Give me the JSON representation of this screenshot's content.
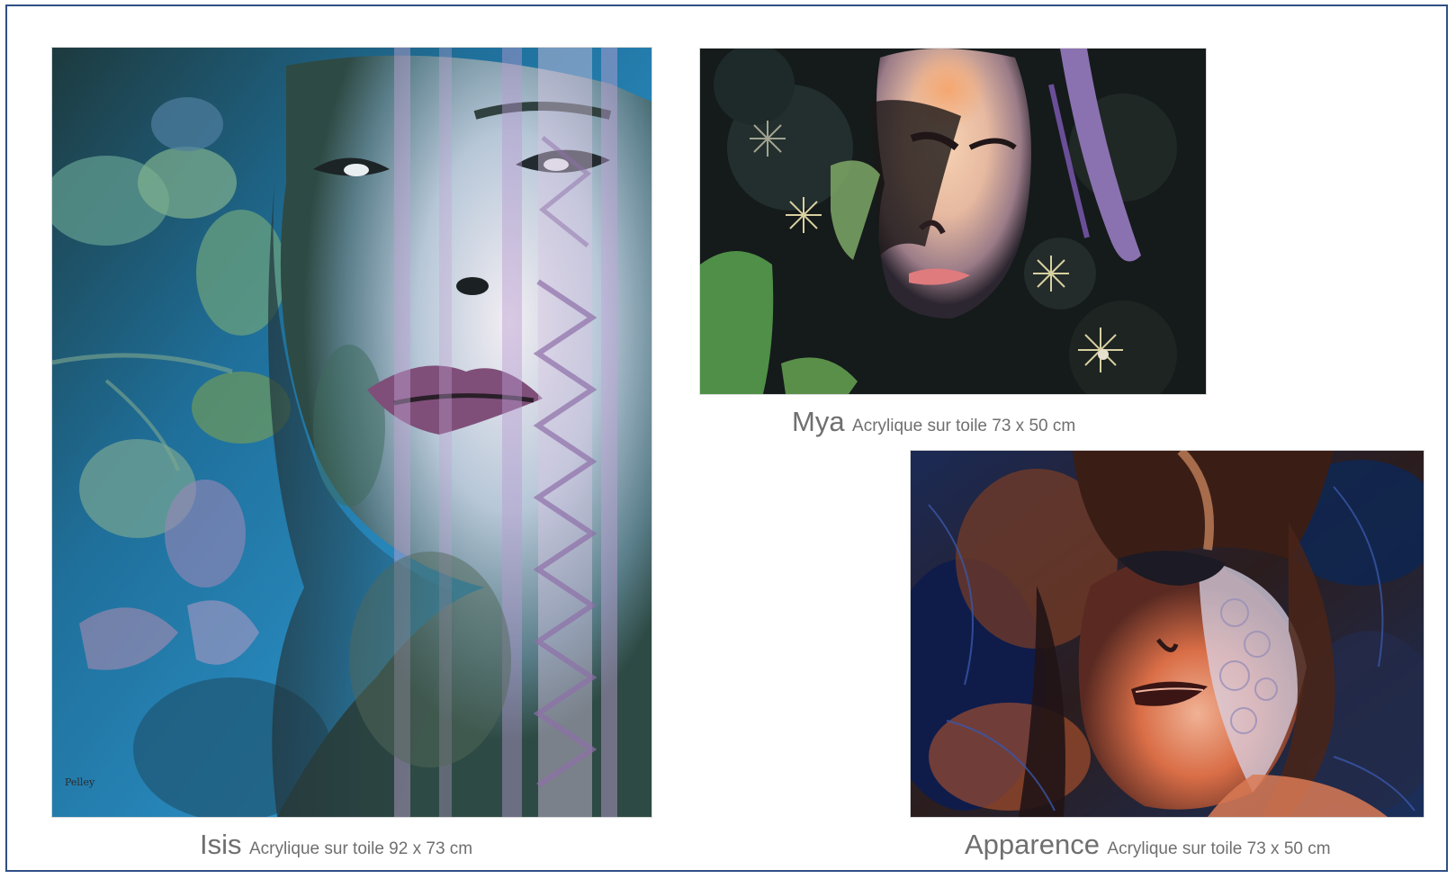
{
  "artworks": {
    "isis": {
      "title": "Isis",
      "details": "Acrylique sur toile 92 x 73 cm",
      "signature": "Pelley"
    },
    "mya": {
      "title": "Mya",
      "details": "Acrylique sur toile 73 x 50 cm"
    },
    "apparence": {
      "title": "Apparence",
      "details": "Acrylique sur toile 73 x 50 cm"
    }
  },
  "colors": {
    "frame_border": "#2f4f86",
    "caption_text": "#6f6f6f",
    "background": "#ffffff"
  }
}
